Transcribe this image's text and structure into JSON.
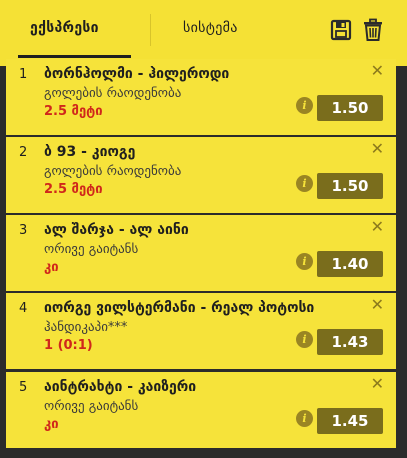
{
  "tabs": [
    {
      "label": "ექსპრესი",
      "active": true
    },
    {
      "label": "სისტემა",
      "active": false
    }
  ],
  "header_icons": [
    "save-icon",
    "trash-icon"
  ],
  "bets": [
    {
      "num": "1",
      "match": "ბორნჰოლმი - ჰილეროდი",
      "market": "გოლების რაოდენობა",
      "pick": "2.5 მეტი",
      "odds": "1.50"
    },
    {
      "num": "2",
      "match": "ბ 93 - კიოგე",
      "market": "გოლების რაოდენობა",
      "pick": "2.5 მეტი",
      "odds": "1.50"
    },
    {
      "num": "3",
      "match": "ალ შარჯა - ალ აინი",
      "market": "ორივე გაიტანს",
      "pick": "კი",
      "odds": "1.40"
    },
    {
      "num": "4",
      "match": "იორგე ვილსტერმანი - რეალ პოტოსი",
      "market": "ჰანდიკაპი***",
      "pick": "1 (0:1)",
      "odds": "1.43"
    },
    {
      "num": "5",
      "match": "აინტრახტი - კაიზერი",
      "market": "ორივე გაიტანს",
      "pick": "კი",
      "odds": "1.45"
    }
  ],
  "colors": {
    "accent": "#f5e135",
    "odds_bg": "#7a6d1c",
    "pick_text": "#d0271b",
    "background": "#2b2b2b"
  }
}
